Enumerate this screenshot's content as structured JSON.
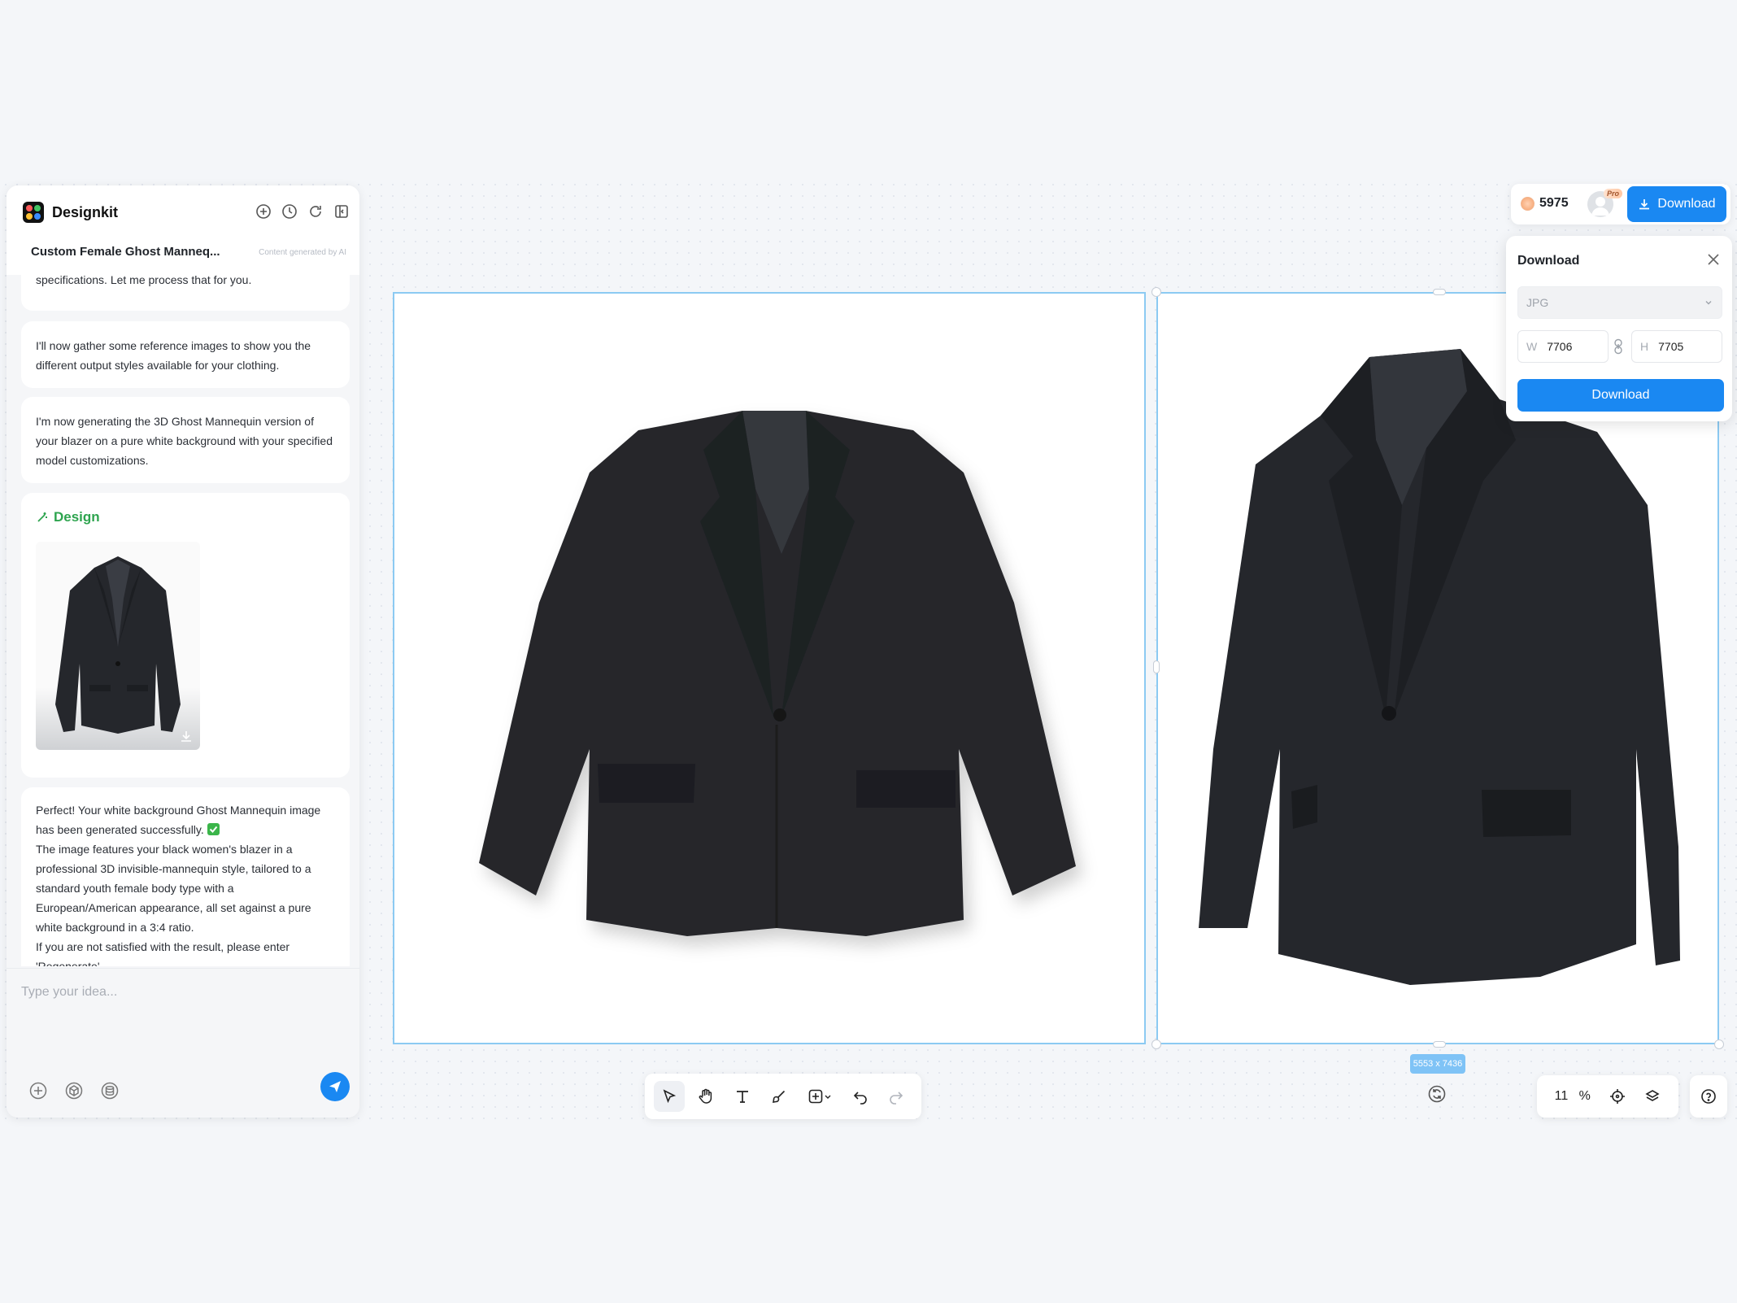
{
  "app": {
    "name": "Designkit",
    "chat_title": "Custom Female Ghost Manneq...",
    "ai_note": "Content generated by AI"
  },
  "messages": {
    "m0": "product image with a customized model fitting your specifications. Let me process that for you.",
    "m1": "I'll now gather some reference images to show you the different output styles available for your clothing.",
    "m2": "I'm now generating the 3D Ghost Mannequin version of your blazer on a pure white background with your specified model customizations.",
    "design_label": "Design",
    "m4_line1": "Perfect! Your white background Ghost Mannequin image has been generated successfully.",
    "m4_line2": "The image features your black women's blazer in a professional 3D invisible-mannequin style, tailored to a standard youth female body type with a European/American appearance, all set against a pure white background in a 3:4 ratio.",
    "m4_line3": "If you are not satisfied with the result, please enter 'Regenerate'"
  },
  "input": {
    "placeholder": "Type your idea..."
  },
  "canvas": {
    "size_badge": "5553 x 7436",
    "zoom_value": "11",
    "zoom_unit": "%"
  },
  "topbar": {
    "credits": "5975",
    "pro_label": "Pro",
    "download_label": "Download"
  },
  "download_panel": {
    "title": "Download",
    "format": "JPG",
    "width_label": "W",
    "width_value": "7706",
    "height_label": "H",
    "height_value": "7705",
    "button_label": "Download"
  },
  "colors": {
    "accent": "#1a88f2",
    "frame_border": "#8ccaf2",
    "design_green": "#2ea44f"
  }
}
